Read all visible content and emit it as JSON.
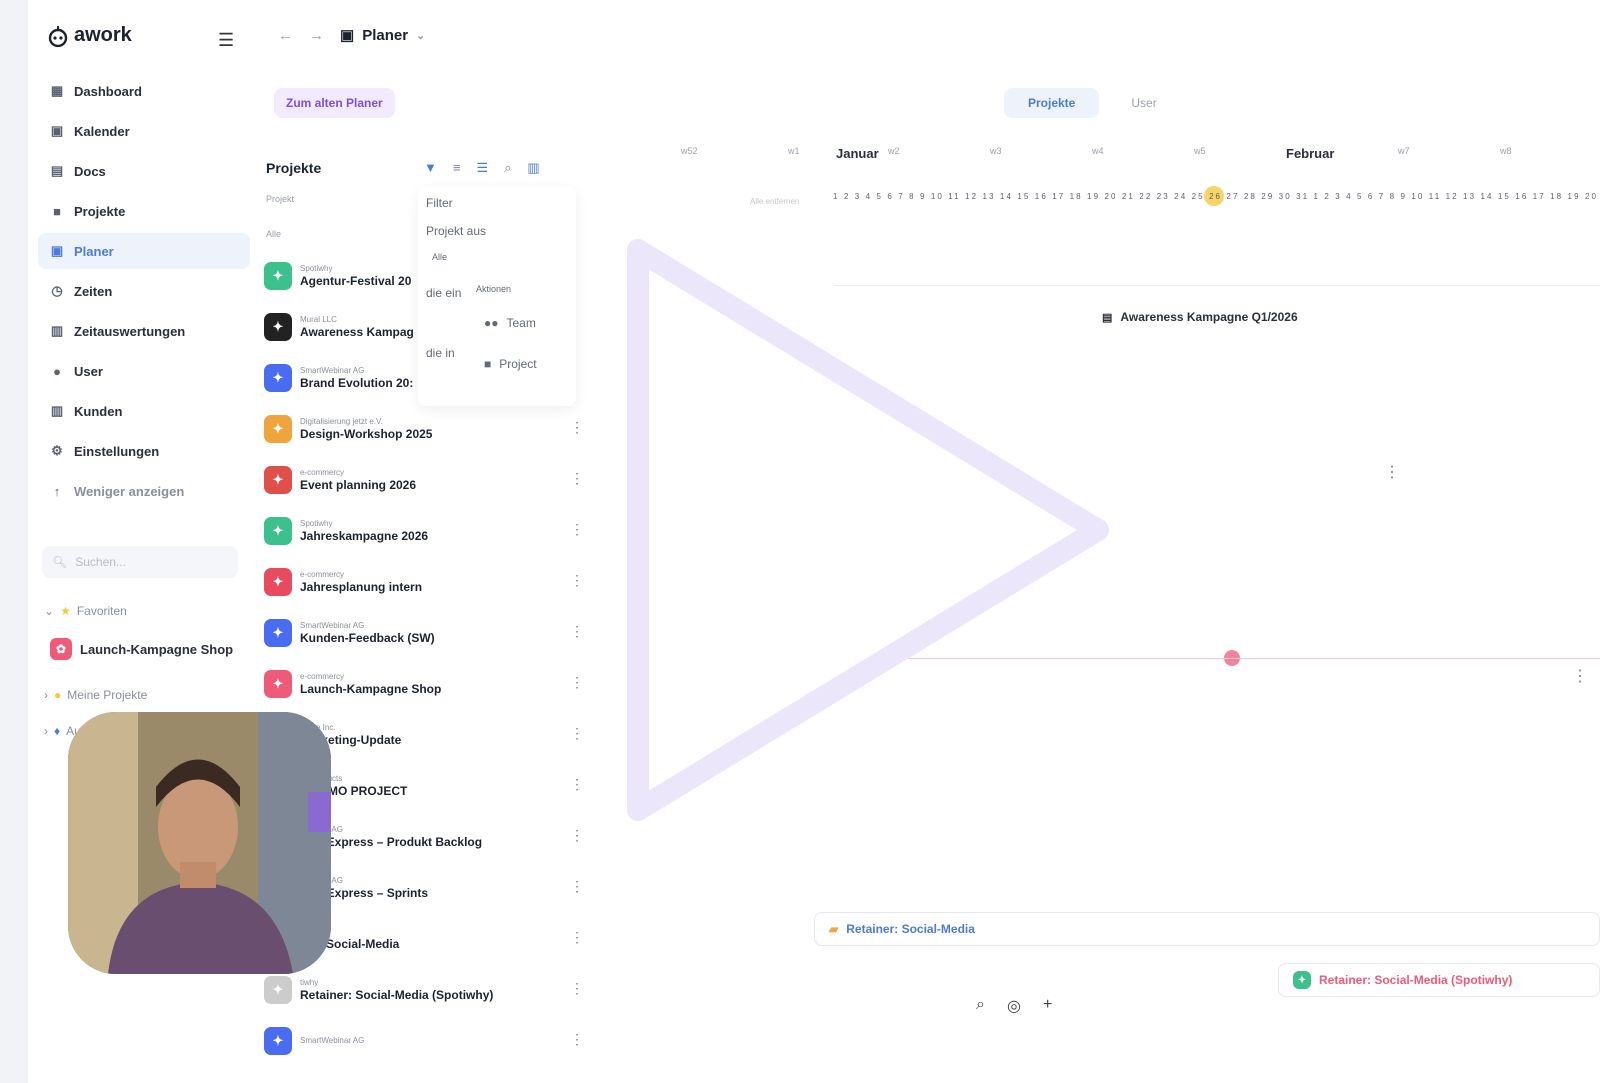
{
  "app": {
    "name": "awork"
  },
  "sidebar": {
    "items": [
      {
        "label": "Dashboard",
        "icon": "dashboard-icon"
      },
      {
        "label": "Kalender",
        "icon": "calendar-icon"
      },
      {
        "label": "Docs",
        "icon": "docs-icon"
      },
      {
        "label": "Projekte",
        "icon": "folder-icon"
      },
      {
        "label": "Planer",
        "icon": "planner-icon",
        "active": true
      },
      {
        "label": "Zeiten",
        "icon": "timer-icon"
      },
      {
        "label": "Zeitauswertungen",
        "icon": "chart-icon"
      },
      {
        "label": "User",
        "icon": "users-icon"
      },
      {
        "label": "Kunden",
        "icon": "customers-icon"
      },
      {
        "label": "Einstellungen",
        "icon": "gear-icon"
      },
      {
        "label": "Weniger anzeigen",
        "icon": "arrow-up-icon"
      }
    ],
    "search_placeholder": "Suchen...",
    "favorites_label": "Favoriten",
    "favorite_item": "Launch-Kampagne Shop",
    "my_projects_label": "Meine Projekte",
    "task_filter_label": "Aufgabenfilter"
  },
  "topbar": {
    "title": "Planer"
  },
  "old_planner_button": "Zum alten Planer",
  "view_toggle": {
    "projects": "Projekte",
    "users": "User"
  },
  "project_list": {
    "title": "Projekte",
    "column_label": "Projekt",
    "group_label": "Alle",
    "rows": [
      {
        "client": "Spotiwhy",
        "name": "Agentur-Festival 20",
        "color": "#3cc08c"
      },
      {
        "client": "Mural LLC",
        "name": "Awareness Kampag",
        "color": "#222222"
      },
      {
        "client": "SmartWebinar AG",
        "name": "Brand Evolution 20:",
        "color": "#4a6cf0"
      },
      {
        "client": "Digitalisierung jetzt e.V.",
        "name": "Design-Workshop 2025",
        "color": "#f0a43c"
      },
      {
        "client": "e-commercy",
        "name": "Event planning 2026",
        "color": "#e0504a"
      },
      {
        "client": "Spotiwhy",
        "name": "Jahreskampagne 2026",
        "color": "#3cc08c"
      },
      {
        "client": "e-commercy",
        "name": "Jahresplanung intern",
        "color": "#e84a5f"
      },
      {
        "client": "SmartWebinar AG",
        "name": "Kunden-Feedback (SW)",
        "color": "#4a6cf0"
      },
      {
        "client": "e-commercy",
        "name": "Launch-Kampagne Shop",
        "color": "#ee5a78"
      },
      {
        "client": "Acme Inc.",
        "name": "Marketing-Update",
        "color": "#e84a5f"
      },
      {
        "client": "rly Products",
        "name": "V DEMO PROJECT",
        "color": "#cccccc"
      },
      {
        "client": "Webinar AG",
        "name": "NomExpress – Produkt Backlog",
        "color": "#cccccc"
      },
      {
        "client": "Webinar AG",
        "name": "NomExpress – Sprints",
        "color": "#cccccc"
      },
      {
        "client": "nc.",
        "name": "ner: Social-Media",
        "color": "#cccccc"
      },
      {
        "client": "tiwhy",
        "name": "Retainer: Social-Media (Spotiwhy)",
        "color": "#cccccc"
      },
      {
        "client": "SmartWebinar AG",
        "name": "",
        "color": "#4a6cf0"
      }
    ]
  },
  "filter_popup": {
    "title": "Filter",
    "line1": "Projekt aus",
    "all": "Alle",
    "line2": "die ein",
    "actions": "Aktionen",
    "team": "Team",
    "line3": "die in",
    "project": "Project"
  },
  "timeline": {
    "remove_all": "Alle entfernen",
    "months": [
      "Januar",
      "Februar"
    ],
    "weeks": [
      "w52",
      "w1",
      "w2",
      "w3",
      "w4",
      "w5",
      "w7",
      "w8"
    ],
    "days": "1 2 3 4 5 6 7 8 9 10 11 12 13 14 15 16 17 18 19 20 21 22 23 24 25 26 27 28 29 30 31 1 2 3 4 5 6 7 8 9 10 11 12 13 14 15 16 17 18 19 20",
    "bars": [
      {
        "label": "Awareness Kampagne Q1/2026",
        "color": "#2b2f3a"
      },
      {
        "label": "Retainer: Social-Media",
        "color": "#4b7bd6"
      },
      {
        "label": "Retainer: Social-Media (Spotiwhy)",
        "color": "#ee5a78"
      }
    ]
  }
}
